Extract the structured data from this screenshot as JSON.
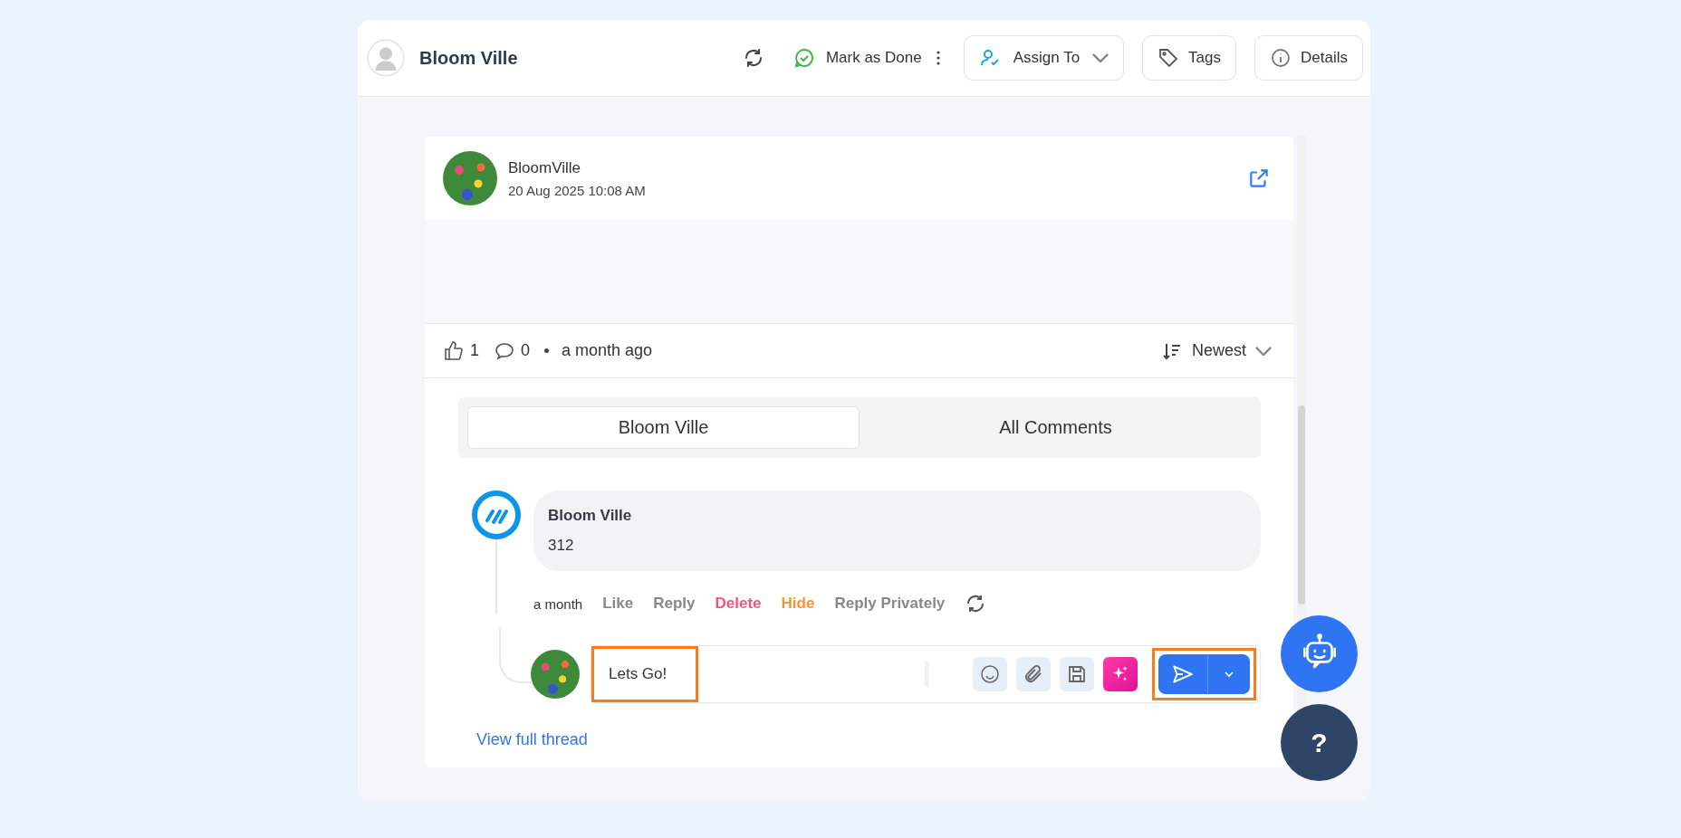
{
  "header": {
    "title": "Bloom Ville",
    "mark_done": "Mark as Done",
    "assign": "Assign To",
    "tags": "Tags",
    "details": "Details"
  },
  "post": {
    "author": "BloomVille",
    "time": "20 Aug 2025 10:08 AM",
    "likes": "1",
    "comments": "0",
    "ago": "a month ago",
    "sort": "Newest"
  },
  "tabs": [
    {
      "label": "Bloom Ville",
      "selected": true
    },
    {
      "label": "All Comments",
      "selected": false
    }
  ],
  "comment": {
    "author": "Bloom Ville",
    "text": "312",
    "time": "a month",
    "actions": [
      {
        "label": "Like",
        "kind": "plain"
      },
      {
        "label": "Reply",
        "kind": "plain"
      },
      {
        "label": "Delete",
        "kind": "danger"
      },
      {
        "label": "Hide",
        "kind": "warning"
      },
      {
        "label": "Reply Privately",
        "kind": "plain"
      }
    ]
  },
  "reply": {
    "value": "Lets Go!",
    "highlighted": true
  },
  "send_highlighted": true,
  "view_thread": "View full thread",
  "help": "?"
}
